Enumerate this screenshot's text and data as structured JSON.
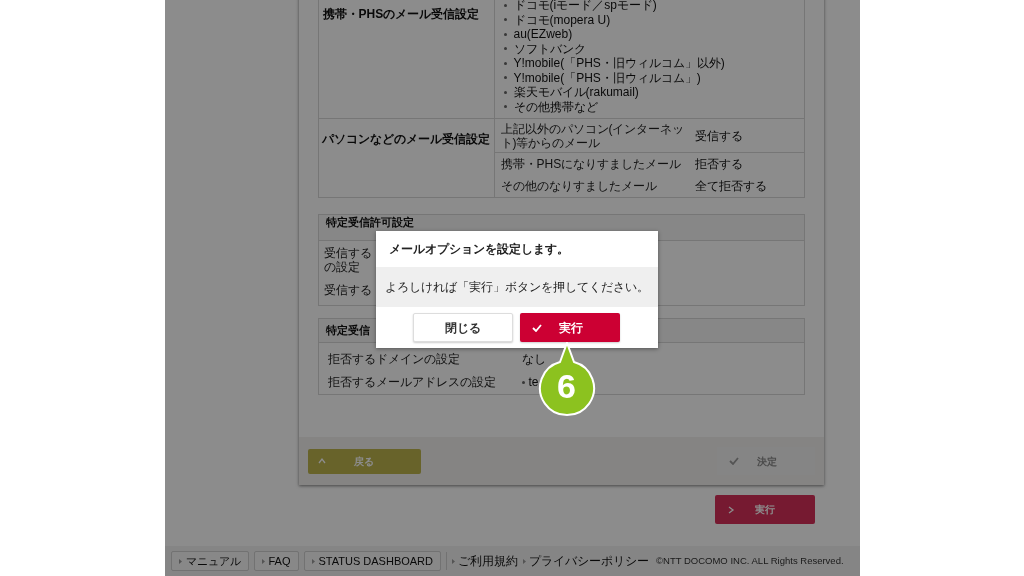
{
  "mobile_section": {
    "label": "携帯・PHSのメール受信設定",
    "carriers": [
      "ドコモ(iモード／spモード)",
      "ドコモ(mopera U)",
      "au(EZweb)",
      "ソフトバンク",
      "Y!mobile(「PHS・旧ウィルコム」以外)",
      "Y!mobile(「PHS・旧ウィルコム」)",
      "楽天モバイル(rakumail)",
      "その他携帯など"
    ]
  },
  "pc_section": {
    "label": "パソコンなどのメール受信設定",
    "rows": [
      {
        "item": "上記以外のパソコン(インターネット)等からのメール",
        "value": "受信する"
      },
      {
        "item": "携帯・PHSになりすましたメール",
        "value": "拒否する"
      },
      {
        "item": "その他のなりすましたメール",
        "value": "全て拒否する"
      }
    ]
  },
  "allow_section": {
    "title": "特定受信許可設定",
    "rows": [
      {
        "lines": [
          "受信する",
          "の設定"
        ]
      },
      {
        "lines": [
          "受信する"
        ]
      }
    ]
  },
  "deny_section": {
    "title": "特定受信",
    "rows": [
      {
        "item": "拒否するドメインの設定",
        "value": "なし"
      },
      {
        "item": "拒否するメールアドレスの設定",
        "bullets": [
          "te"
        ]
      }
    ]
  },
  "card_footer": {
    "back": "戻る",
    "confirm": {
      "label": "決定",
      "disabled": true
    }
  },
  "execute_button": "実行",
  "footer": {
    "buttons": [
      "マニュアル",
      "FAQ",
      "STATUS DASHBOARD"
    ],
    "links": [
      "ご利用規約",
      "プライバシーポリシー"
    ],
    "copyright": "©NTT DOCOMO INC. ALL Rights Reserved."
  },
  "dialog": {
    "title": "メールオプションを設定します。",
    "message": "よろしければ「実行」ボタンを押してください。",
    "buttons": [
      {
        "label": "閉じる",
        "kind": "secondary"
      },
      {
        "label": "実行",
        "kind": "primary"
      }
    ]
  },
  "step_marker": "6"
}
